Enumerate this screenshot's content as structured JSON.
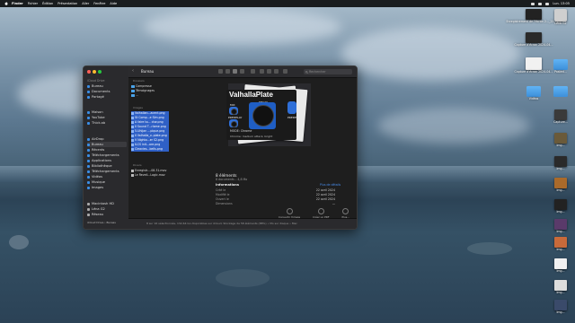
{
  "menubar": {
    "app": "Finder",
    "items": [
      "Fichier",
      "Édition",
      "Présentation",
      "Aller",
      "Fenêtre",
      "Aide"
    ],
    "clock": "Lun. 13:05"
  },
  "finder": {
    "title": "Bureau",
    "search_placeholder": "Rechercher",
    "sidebar": {
      "icloud_section": "iCloud Drive",
      "icloud_items": [
        "Bureau",
        "Documents",
        "Partagé"
      ],
      "favorites": [
        "Maison",
        "YouTube",
        "Thick.ab"
      ],
      "mid_items": [
        "AirDrop",
        "Bureau",
        "Récents",
        "Téléchargements",
        "Applications",
        "Bibliothèque",
        "Téléchargements",
        "Vidéos",
        "Musique",
        "Images"
      ],
      "devices": [
        "Macintosh HD",
        "Léna G2",
        "Réseau"
      ]
    },
    "col1": {
      "header": "Dossiers",
      "items": [
        "Compresse",
        "Témoignages",
        "..."
      ]
    },
    "col1_images": {
      "header": "Images",
      "items": [
        "Valhallan...acent.png",
        "St Comp...e Slm.png",
        "A faire to... ctor.png",
        "Il Sound T...rlame.png",
        "5-Uhljan ...pique.png",
        "Il Valhalla_v..plate.png",
        "V Nighto...er S2.png",
        "ILCS init...ore.png",
        "Cleavies...bells.png"
      ]
    },
    "col1_docs": {
      "header": "Divers",
      "items": [
        "Enregistr...-08.31.mov",
        "Le Reveil...Logic.mov"
      ]
    },
    "plugin": {
      "title": "ValhallaPlate",
      "knob_labels": [
        "MIX",
        "DECAY",
        "PREDELAY",
        "PREDE"
      ],
      "mode": "MODE: Chrome",
      "desc": "Chrome: medium attack, bright"
    },
    "info": {
      "count": "8 éléments",
      "sub": "8 documents – 4,8 Mo",
      "header": "Informations",
      "more": "Plus de détails",
      "rows": [
        {
          "k": "Créé le",
          "v": "22 avril 2024"
        },
        {
          "k": "Modifié le",
          "v": "22 avril 2024"
        },
        {
          "k": "Ouvert le",
          "v": "22 avril 2024"
        },
        {
          "k": "Dimensions",
          "v": "—"
        }
      ]
    },
    "actions": [
      "Convertir l'image",
      "Créer un PDF",
      "Plus..."
    ],
    "status": "8 sur 16 sélectionnés, 132,64 Go disponibles sur iCloud, Stockage de 58 éléments (88%) • Mo sur disque • Mac",
    "path": "iCloud Drive › Bureau"
  },
  "desktop": {
    "items": [
      {
        "label": "Enregistrement de l'écran 2..._21 mov",
        "type": "file"
      },
      {
        "label": "Léna G2",
        "type": "disk"
      },
      {
        "label": "Capture d'écran 2024-04...",
        "type": "file"
      },
      {
        "label": "Capture d'écran 2024-04...",
        "type": "file"
      },
      {
        "label": "Pasted...",
        "type": "folder"
      },
      {
        "label": "",
        "type": "folder"
      },
      {
        "label": "Vidéos",
        "type": "folder"
      },
      {
        "label": "Capture...",
        "type": "file"
      },
      {
        "label": "Img...",
        "type": "file"
      },
      {
        "label": "Img...",
        "type": "file"
      },
      {
        "label": "Img...",
        "type": "file"
      },
      {
        "label": "Img...",
        "type": "file"
      },
      {
        "label": "Img...",
        "type": "file"
      },
      {
        "label": "Img...",
        "type": "file"
      },
      {
        "label": "Img...",
        "type": "file"
      },
      {
        "label": "Img...",
        "type": "file"
      },
      {
        "label": "Img...",
        "type": "file"
      }
    ]
  }
}
